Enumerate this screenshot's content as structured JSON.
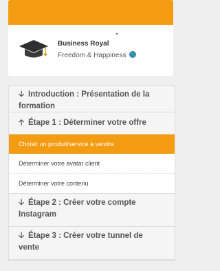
{
  "profile": {
    "name": "Business Royal",
    "tagline": "Freedom & Happiness",
    "avatar_icon": "graduation-cap-icon",
    "accent_color": "#f39c12"
  },
  "menu": {
    "sections": [
      {
        "label": "Introduction : Présentation de la formation",
        "icon": "arrow-down-icon",
        "expanded": false
      },
      {
        "label": "Étape 1 : Déterminer votre offre",
        "icon": "arrow-up-icon",
        "expanded": true
      },
      {
        "label": "Étape 2 : Créer votre compte Instagram",
        "icon": "arrow-down-icon",
        "expanded": false
      },
      {
        "label": "Étape 3 : Créer votre tunnel de vente",
        "icon": "arrow-down-icon",
        "expanded": false
      }
    ],
    "lessons": [
      "Choisir un produit/service à vendre",
      "Déterminer votre avatar client",
      "Déterminer votre contenu"
    ]
  }
}
